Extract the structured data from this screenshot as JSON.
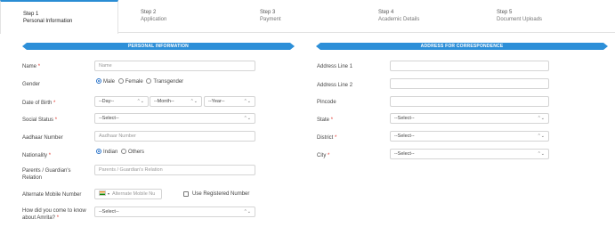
{
  "steps": [
    {
      "num": "Step 1",
      "title": "Personal Information"
    },
    {
      "num": "Step 2",
      "title": "Application"
    },
    {
      "num": "Step 3",
      "title": "Payment"
    },
    {
      "num": "Step 4",
      "title": "Academic Details"
    },
    {
      "num": "Step 5",
      "title": "Document Uploads"
    }
  ],
  "sections": {
    "personal": "PERSONAL INFORMATION",
    "address": "ADDRESS FOR CORRESPONDENCE"
  },
  "personal": {
    "name": {
      "label": "Name",
      "placeholder": "Name"
    },
    "gender": {
      "label": "Gender",
      "options": [
        "Male",
        "Female",
        "Transgender"
      ],
      "selected": "Male"
    },
    "dob": {
      "label": "Date of Birth",
      "day": "--Day--",
      "month": "--Month--",
      "year": "--Year--"
    },
    "social_status": {
      "label": "Social Status",
      "value": "--Select--"
    },
    "aadhaar": {
      "label": "Aadhaar Number",
      "placeholder": "Aadhaar Number"
    },
    "nationality": {
      "label": "Nationality",
      "options": [
        "Indian",
        "Others"
      ],
      "selected": "Indian"
    },
    "guardian_relation": {
      "label_line1": "Parents / Guardian's",
      "label_line2": "Relation",
      "placeholder": "Parents / Guardian's Relation"
    },
    "alt_mobile": {
      "label": "Alternate Mobile Number",
      "placeholder": "Alternate Mobile Nu",
      "checkbox_label": "Use Registered Number"
    },
    "how_know": {
      "label_line1": "How did you come to know",
      "label_line2": "about Amrita?",
      "value": "--Select--"
    }
  },
  "address": {
    "line1": {
      "label": "Address Line 1"
    },
    "line2": {
      "label": "Address Line 2"
    },
    "pincode": {
      "label": "Pincode"
    },
    "state": {
      "label": "State",
      "value": "--Select--"
    },
    "district": {
      "label": "District",
      "value": "--Select--"
    },
    "city": {
      "label": "City",
      "value": "--Select--"
    }
  },
  "required_mark": "*",
  "colors": {
    "accent": "#2d8fd8",
    "required": "#e0342a"
  }
}
